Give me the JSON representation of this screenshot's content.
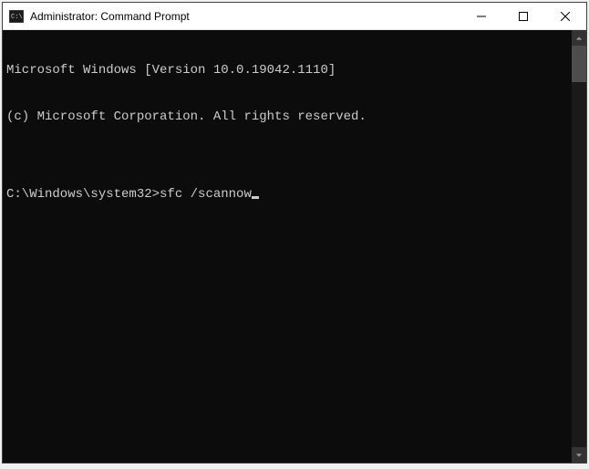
{
  "window": {
    "title": "Administrator: Command Prompt"
  },
  "terminal": {
    "line1": "Microsoft Windows [Version 10.0.19042.1110]",
    "line2": "(c) Microsoft Corporation. All rights reserved.",
    "blank1": "",
    "prompt": "C:\\Windows\\system32>",
    "command": "sfc /scannow"
  }
}
